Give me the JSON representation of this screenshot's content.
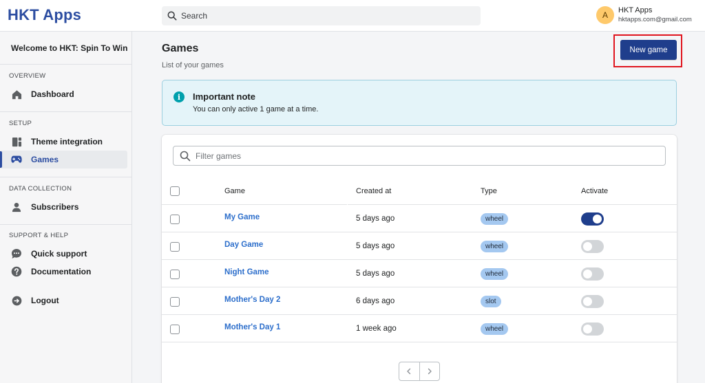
{
  "app": {
    "brand": "HKT Apps"
  },
  "search": {
    "placeholder": "Search"
  },
  "user": {
    "initial": "A",
    "name": "HKT Apps",
    "email": "hktapps.com@gmail.com"
  },
  "sidebar": {
    "welcome": "Welcome to HKT: Spin To Win",
    "sections": [
      {
        "title": "OVERVIEW",
        "items": [
          {
            "label": "Dashboard",
            "icon": "home-icon"
          }
        ]
      },
      {
        "title": "SETUP",
        "items": [
          {
            "label": "Theme integration",
            "icon": "theme-icon"
          },
          {
            "label": "Games",
            "icon": "gamepad-icon",
            "active": true
          }
        ]
      },
      {
        "title": "DATA COLLECTION",
        "items": [
          {
            "label": "Subscribers",
            "icon": "person-icon"
          }
        ]
      },
      {
        "title": "SUPPORT & HELP",
        "items": [
          {
            "label": "Quick support",
            "icon": "chat-icon"
          },
          {
            "label": "Documentation",
            "icon": "question-icon"
          }
        ]
      }
    ],
    "logout": {
      "label": "Logout",
      "icon": "logout-icon"
    }
  },
  "main": {
    "title": "Games",
    "subtitle": "List of your games",
    "new_button": "New game",
    "note": {
      "title": "Important note",
      "text": "You can only active 1 game at a time.",
      "icon": "info-icon"
    },
    "filter": {
      "placeholder": "Filter games"
    },
    "table": {
      "headers": [
        "Game",
        "Created at",
        "Type",
        "Activate"
      ],
      "rows": [
        {
          "game": "My Game",
          "created": "5 days ago",
          "type": "wheel",
          "active": true
        },
        {
          "game": "Day Game",
          "created": "5 days ago",
          "type": "wheel",
          "active": false
        },
        {
          "game": "Night Game",
          "created": "5 days ago",
          "type": "wheel",
          "active": false
        },
        {
          "game": "Mother's Day 2",
          "created": "6 days ago",
          "type": "slot",
          "active": false
        },
        {
          "game": "Mother's Day 1",
          "created": "1 week ago",
          "type": "wheel",
          "active": false
        }
      ]
    },
    "pagination": {
      "prev_icon": "chevron-left-icon",
      "next_icon": "chevron-right-icon"
    }
  },
  "colors": {
    "brand": "#2c4da1",
    "primary_button": "#1f3e8c",
    "link": "#2c6ecb",
    "highlight": "#e0141e",
    "badge": "#a4c8f0"
  }
}
